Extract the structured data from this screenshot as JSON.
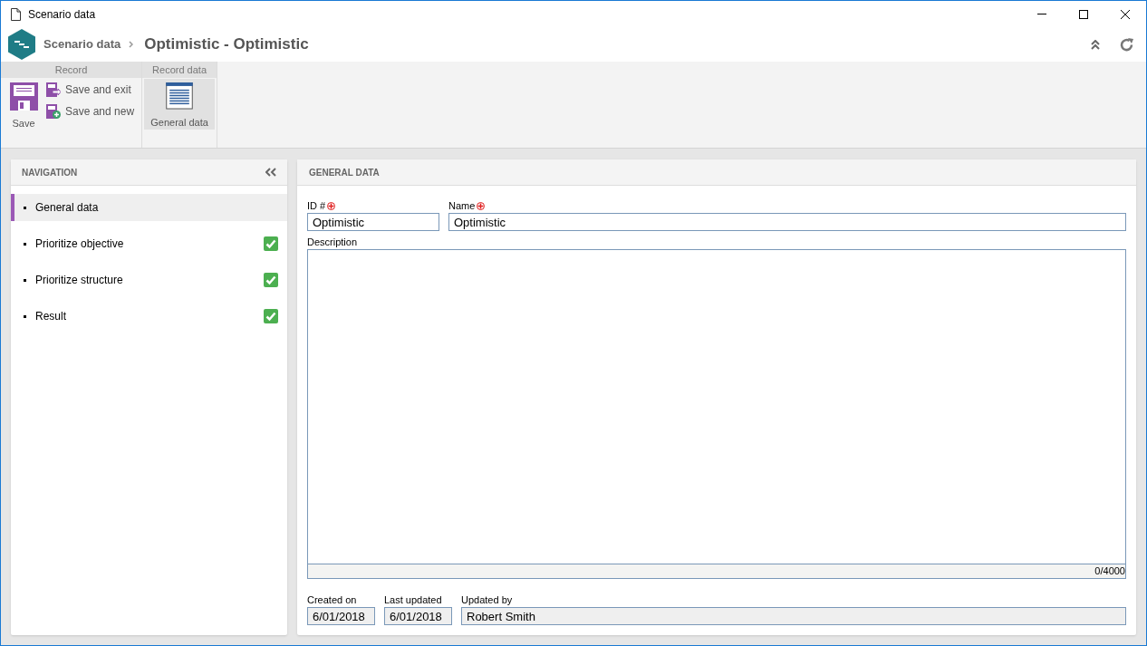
{
  "window": {
    "title": "Scenario data"
  },
  "header": {
    "breadcrumb": "Scenario data",
    "title": "Optimistic - Optimistic"
  },
  "ribbon": {
    "groups": [
      {
        "label": "Record",
        "buttons": [
          {
            "label": "Save",
            "kind": "save"
          },
          {
            "label": "Save and exit",
            "kind": "save-exit"
          },
          {
            "label": "Save and new",
            "kind": "save-new"
          }
        ]
      },
      {
        "label": "Record data",
        "buttons": [
          {
            "label": "General data",
            "kind": "general",
            "selected": true
          }
        ]
      }
    ]
  },
  "navigation": {
    "title": "NAVIGATION",
    "items": [
      {
        "label": "General data",
        "selected": true,
        "done": false
      },
      {
        "label": "Prioritize objective",
        "selected": false,
        "done": true
      },
      {
        "label": "Prioritize structure",
        "selected": false,
        "done": true
      },
      {
        "label": "Result",
        "selected": false,
        "done": true
      }
    ]
  },
  "form": {
    "title": "GENERAL DATA",
    "id": {
      "label": "ID #",
      "value": "Optimistic",
      "required": true
    },
    "name": {
      "label": "Name",
      "value": "Optimistic",
      "required": true
    },
    "description": {
      "label": "Description",
      "counter": "0/4000"
    },
    "footer": [
      {
        "label": "Created on",
        "value": "6/01/2018"
      },
      {
        "label": "Last updated",
        "value": "6/01/2018"
      },
      {
        "label": "Updated by",
        "value": "Robert Smith"
      }
    ]
  }
}
